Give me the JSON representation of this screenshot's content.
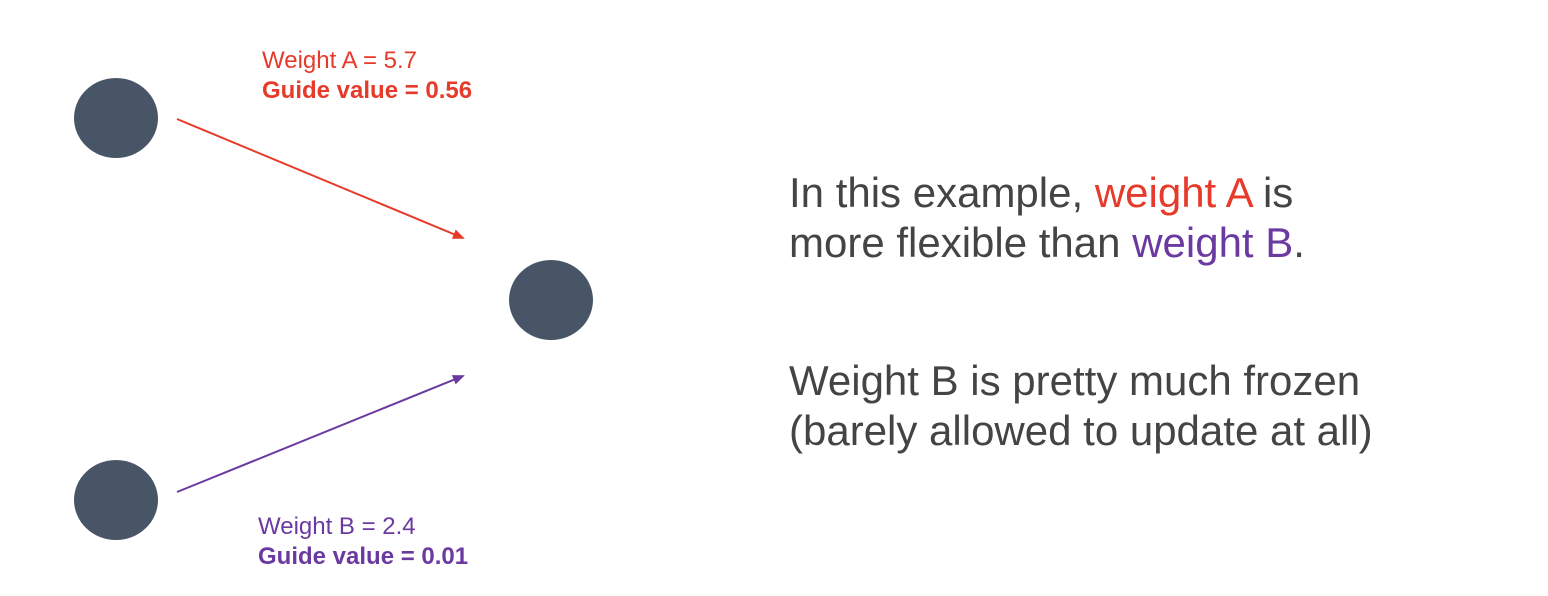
{
  "colors": {
    "weight_a": "#e63a2a",
    "weight_b": "#6b3aa0",
    "node": "#485566",
    "text": "#444444",
    "background": "#ffffff"
  },
  "nodes": [
    {
      "id": "input-node-top"
    },
    {
      "id": "output-node"
    },
    {
      "id": "input-node-bottom"
    }
  ],
  "edges": [
    {
      "from": "input-node-top",
      "to": "output-node",
      "color": "#e63a2a"
    },
    {
      "from": "input-node-bottom",
      "to": "output-node",
      "color": "#6b3aa0"
    }
  ],
  "weight_a": {
    "weight_text": "Weight A = 5.7",
    "guide_text": "Guide value = 0.56"
  },
  "weight_b": {
    "weight_text": "Weight B = 2.4",
    "guide_text": "Guide value = 0.01"
  },
  "explanation": {
    "paragraph1": {
      "line1_prefix": "In this example, ",
      "line1_highlight": "weight A",
      "line1_suffix": " is",
      "line2_prefix": "more flexible than ",
      "line2_highlight": "weight B",
      "line2_suffix": "."
    },
    "paragraph2": {
      "line1": "Weight B is pretty much frozen",
      "line2": "(barely allowed to update at all)"
    }
  }
}
